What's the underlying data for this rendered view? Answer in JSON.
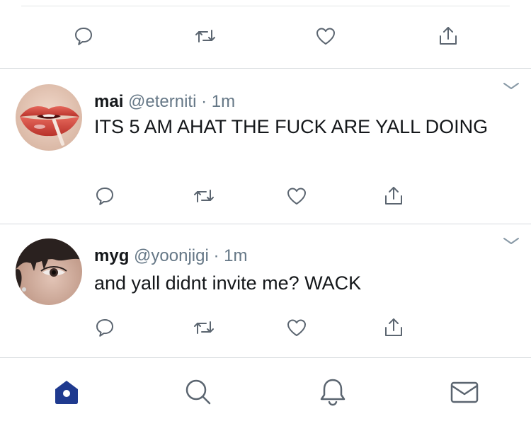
{
  "colors": {
    "accent": "#1f3a8f",
    "icon_gray": "#5b6570",
    "text_primary": "#14171a",
    "text_secondary": "#657786",
    "divider": "#d6dadd"
  },
  "previous_tweet_actions": [
    {
      "name": "reply",
      "icon": "reply-icon"
    },
    {
      "name": "retweet",
      "icon": "retweet-icon"
    },
    {
      "name": "like",
      "icon": "heart-icon"
    },
    {
      "name": "share",
      "icon": "share-icon"
    }
  ],
  "tweets": [
    {
      "display_name": "mai",
      "handle": "@eterniti",
      "separator": "·",
      "time": "1m",
      "text": "ITS 5 AM AHAT THE FUCK ARE YALL DOING",
      "avatar": "lips-avatar"
    },
    {
      "display_name": "myg",
      "handle": "@yoonjigi",
      "separator": "·",
      "time": "1m",
      "text": "and yall didnt invite me? WACK",
      "avatar": "face-avatar"
    }
  ],
  "tab_bar": [
    {
      "name": "home",
      "icon": "home-icon",
      "active": true
    },
    {
      "name": "search",
      "icon": "search-icon",
      "active": false
    },
    {
      "name": "notifications",
      "icon": "bell-icon",
      "active": false
    },
    {
      "name": "messages",
      "icon": "mail-icon",
      "active": false
    }
  ]
}
